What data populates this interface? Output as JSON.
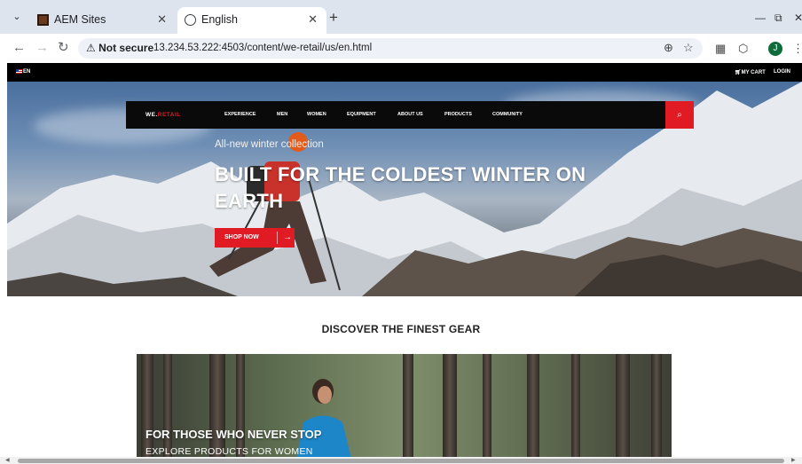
{
  "browser": {
    "tabs": [
      {
        "title": "AEM Sites",
        "active": false,
        "icon": "aem-icon"
      },
      {
        "title": "English",
        "active": true,
        "icon": "globe-icon"
      }
    ],
    "security_label": "Not secure",
    "url": "13.234.53.222:4503/content/we-retail/us/en.html",
    "profile_initial": "J"
  },
  "site": {
    "lang": "EN",
    "cart": "MY CART",
    "login": "LOGIN",
    "logo": {
      "part1": "WE.",
      "part2": "RETAIL"
    },
    "nav": [
      "EXPERIENCE",
      "MEN",
      "WOMEN",
      "EQUIPMENT",
      "ABOUT US",
      "PRODUCTS",
      "COMMUNITY"
    ],
    "hero": {
      "kicker": "All-new winter collection",
      "headline": "BUILT FOR THE COLDEST WINTER ON EARTH",
      "cta": "SHOP NOW"
    },
    "section_title": "DISCOVER THE FINEST GEAR",
    "banner": {
      "title": "FOR THOSE WHO NEVER STOP",
      "subtitle": "EXPLORE PRODUCTS FOR WOMEN"
    }
  },
  "colors": {
    "accent": "#e01b24",
    "nav_bg": "#0a0a0a"
  }
}
